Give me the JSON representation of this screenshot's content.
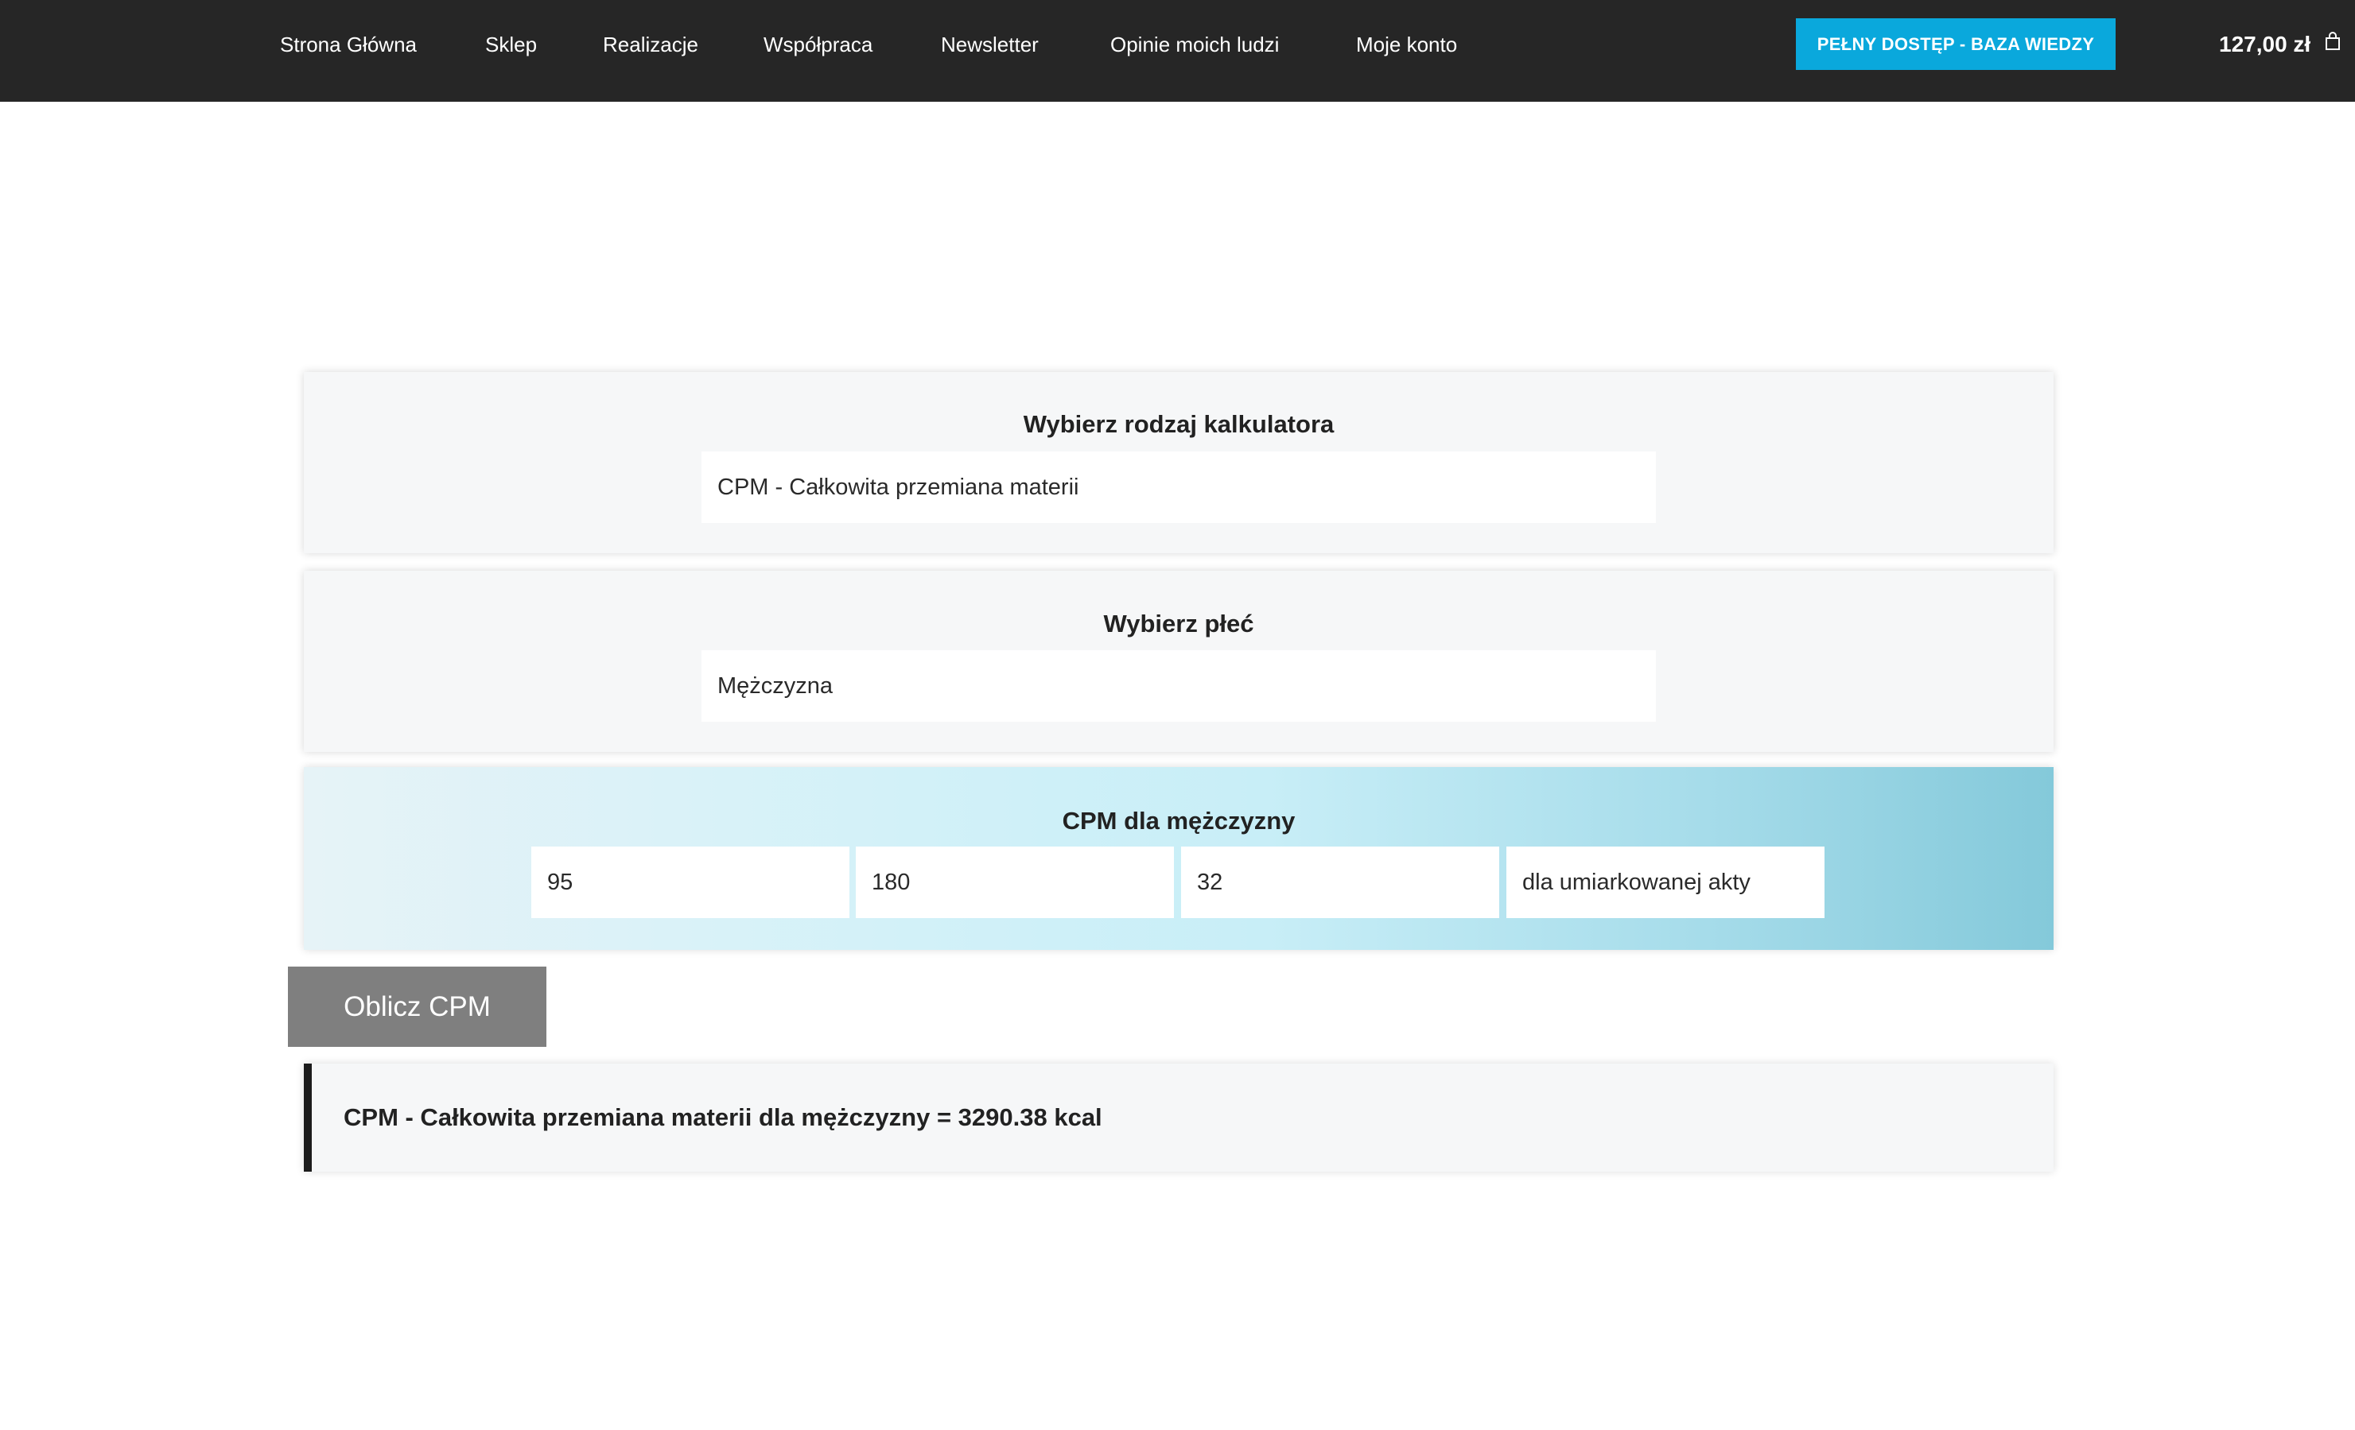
{
  "nav": {
    "items": [
      {
        "label": "Strona Główna"
      },
      {
        "label": "Sklep"
      },
      {
        "label": "Realizacje"
      },
      {
        "label": "Współpraca"
      },
      {
        "label": "Newsletter"
      },
      {
        "label": "Opinie moich ludzi"
      },
      {
        "label": "Moje konto"
      }
    ],
    "cta_label": "PEŁNY DOSTĘP - BAZA WIEDZY",
    "cart_total": "127,00 zł",
    "cart_icon": "shopping-bag-icon"
  },
  "calculator_type": {
    "title": "Wybierz rodzaj kalkulatora",
    "selected": "CPM - Całkowita przemiana materii"
  },
  "gender": {
    "title": "Wybierz płeć",
    "selected": "Mężczyzna"
  },
  "cpm_inputs": {
    "title": "CPM dla mężczyzny",
    "weight": "95",
    "height": "180",
    "age": "32",
    "activity": "dla umiarkowanej akty"
  },
  "calculate_button": {
    "label": "Oblicz CPM"
  },
  "result": {
    "text": "CPM - Całkowita przemiana materii dla mężczyzny = 3290.38 kcal"
  },
  "colors": {
    "topbar": "#262626",
    "accent": "#0aa8dc",
    "button": "#7f7f7f"
  }
}
